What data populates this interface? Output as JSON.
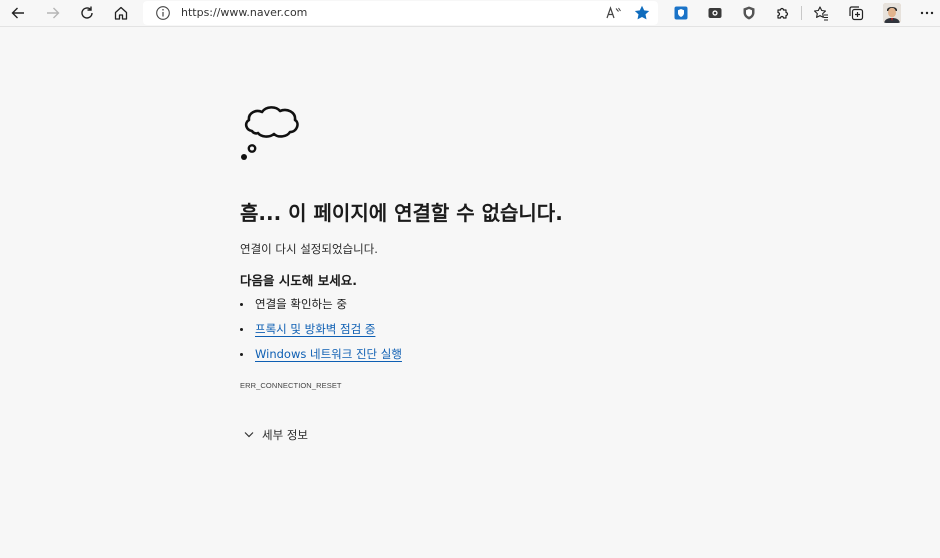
{
  "browser": {
    "url": "https://www.naver.com",
    "read_aloud_label": "A̅",
    "accent_color": "#0f6cbd"
  },
  "error_page": {
    "heading": "흠... 이 페이지에 연결할 수 없습니다.",
    "subtext": "연결이 다시 설정되었습니다.",
    "try_heading": "다음을 시도해 보세요.",
    "suggestions": [
      "연결을 확인하는 중",
      "프록시 및 방화벽 점검 중",
      "Windows 네트워크 진단 실행"
    ],
    "error_code": "ERR_CONNECTION_RESET",
    "details_label": "세부 정보"
  },
  "icons": {
    "back": "back-arrow-icon",
    "forward": "forward-arrow-icon",
    "refresh": "refresh-icon",
    "home": "home-icon",
    "info": "info-icon",
    "read_aloud": "read-aloud-icon",
    "favorite": "star-icon",
    "extensions": [
      "shield-extension-icon",
      "camera-extension-icon",
      "adblock-extension-icon",
      "puzzle-icon"
    ],
    "favorites_bar": "favorites-icon",
    "collections": "collections-icon",
    "more": "more-icon",
    "cloud": "thought-cloud-icon",
    "expand": "chevron-down-icon"
  }
}
